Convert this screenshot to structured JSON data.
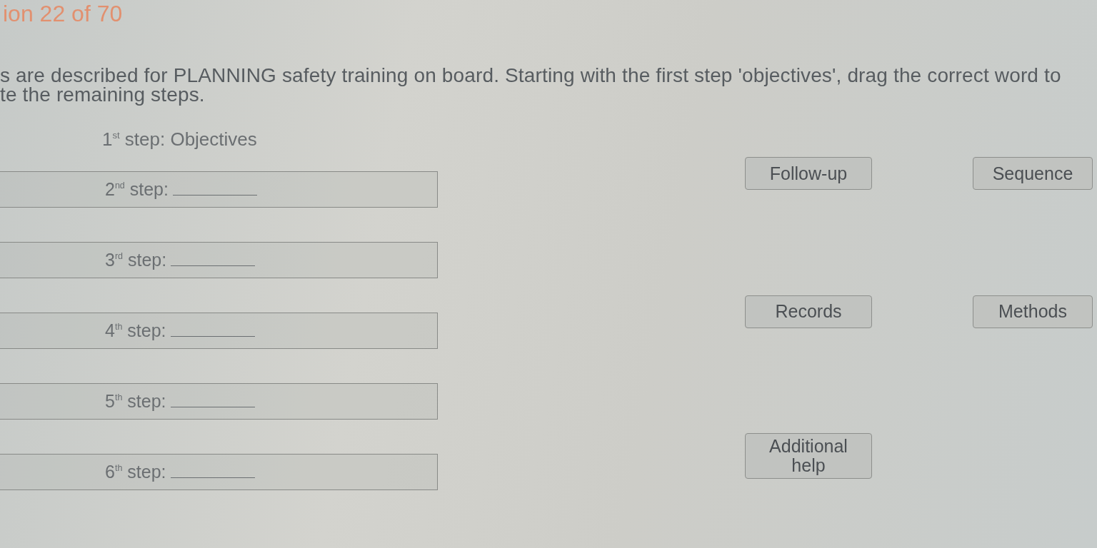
{
  "header": {
    "question_counter": "ion 22 of 70"
  },
  "instruction_lines": [
    "s are described for PLANNING safety training on board. Starting with the first step 'objectives', drag the correct word to",
    "te the remaining steps."
  ],
  "given_step": {
    "label": "1$^{st}$ step: Objectives"
  },
  "drop_zones": [
    {
      "label": "2$^{nd}$ step:"
    },
    {
      "label": "3$^{rd}$ step:"
    },
    {
      "label": "4$^{th}$ step:"
    },
    {
      "label": "5$^{th}$ step:"
    },
    {
      "label": "6$^{th}$ step:"
    }
  ],
  "word_tiles": [
    {
      "text": "Follow-up"
    },
    {
      "text": "Sequence"
    },
    {
      "text": "Records"
    },
    {
      "text": "Methods"
    },
    {
      "text": "Additional help"
    }
  ]
}
